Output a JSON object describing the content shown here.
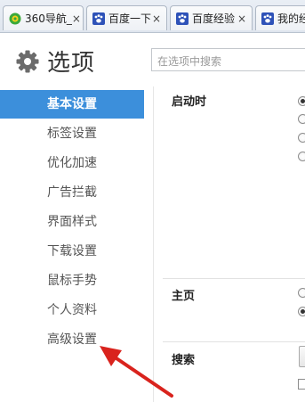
{
  "tabs": [
    {
      "label": "360导航_",
      "icon": "360-logo-icon"
    },
    {
      "label": "百度一下",
      "icon": "paw-icon"
    },
    {
      "label": "百度经验",
      "icon": "paw-icon"
    },
    {
      "label": "我的经",
      "icon": "paw-icon"
    }
  ],
  "tab_close": "×",
  "header": {
    "title": "选项",
    "search_placeholder": "在选项中搜索"
  },
  "sidebar": {
    "items": [
      {
        "label": "基本设置",
        "active": true
      },
      {
        "label": "标签设置"
      },
      {
        "label": "优化加速"
      },
      {
        "label": "广告拦截"
      },
      {
        "label": "界面样式"
      },
      {
        "label": "下载设置"
      },
      {
        "label": "鼠标手势"
      },
      {
        "label": "个人资料"
      },
      {
        "label": "高级设置"
      }
    ]
  },
  "sections": {
    "startup": "启动时",
    "homepage": "主页",
    "search": "搜索"
  },
  "colors": {
    "active_nav": "#3c8fdb",
    "annotation_arrow": "#d9231d"
  }
}
